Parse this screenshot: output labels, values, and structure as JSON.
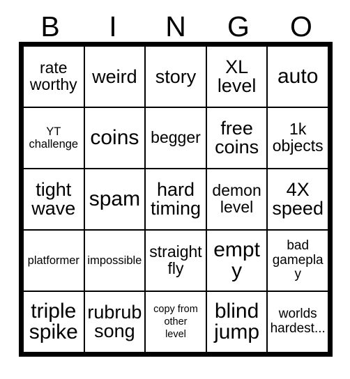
{
  "card": {
    "title": "BINGO",
    "header_letters": [
      "B",
      "I",
      "N",
      "G",
      "O"
    ],
    "background_color": "#ffffff",
    "border_color": "#000000",
    "text_color": "#000000",
    "rows": 5,
    "columns": 5,
    "cells": [
      [
        {
          "text": "rate\nworthy",
          "size": "lg"
        },
        {
          "text": "weird",
          "size": "xl"
        },
        {
          "text": "story",
          "size": "xl"
        },
        {
          "text": "XL\nlevel",
          "size": "xl"
        },
        {
          "text": "auto",
          "size": "xxl"
        }
      ],
      [
        {
          "text": "YT\nchallenge",
          "size": "sm"
        },
        {
          "text": "coins",
          "size": "xxl"
        },
        {
          "text": "begger",
          "size": "lg"
        },
        {
          "text": "free\ncoins",
          "size": "xl"
        },
        {
          "text": "1k\nobjects",
          "size": "lg"
        }
      ],
      [
        {
          "text": "tight\nwave",
          "size": "xl"
        },
        {
          "text": "spam",
          "size": "xxl"
        },
        {
          "text": "hard\ntiming",
          "size": "xl"
        },
        {
          "text": "demon\nlevel",
          "size": "lg"
        },
        {
          "text": "4X\nspeed",
          "size": "xl"
        }
      ],
      [
        {
          "text": "platformer",
          "size": "sm"
        },
        {
          "text": "impossible",
          "size": "sm"
        },
        {
          "text": "straight\nfly",
          "size": "lg"
        },
        {
          "text": "empty",
          "size": "xxl"
        },
        {
          "text": "bad\ngameplay",
          "size": "md"
        }
      ],
      [
        {
          "text": "triple\nspike",
          "size": "xxl"
        },
        {
          "text": "rubrub\nsong",
          "size": "xl"
        },
        {
          "text": "copy from\nother\nlevel",
          "size": "xs"
        },
        {
          "text": "blind\njump",
          "size": "xxl"
        },
        {
          "text": "worlds\nhardest...",
          "size": "md"
        }
      ]
    ]
  }
}
